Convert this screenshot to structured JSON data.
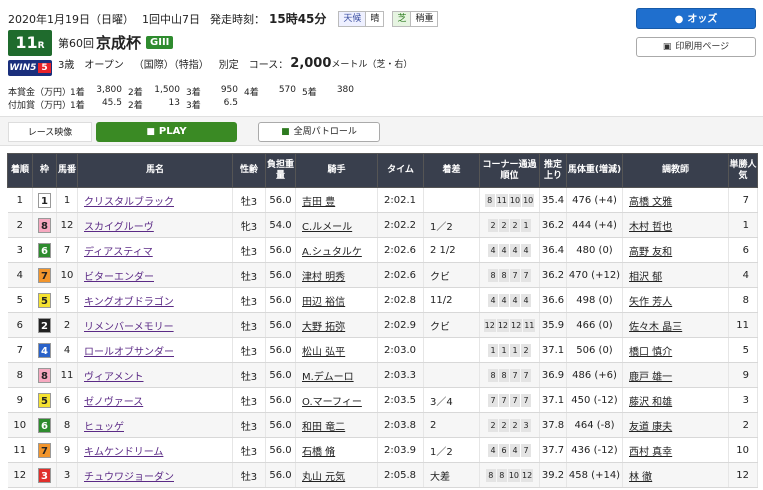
{
  "header": {
    "date": "2020年1月19日（日曜）",
    "meeting": "1回中山7日",
    "post_time_label": "発走時刻：",
    "post_time": "15時45分",
    "weather_label": "天候",
    "weather": "晴",
    "surface_label": "芝",
    "going": "稍重",
    "race_number": "11",
    "race_suffix": "R",
    "win5_label": "WIN5",
    "win5_number": "5",
    "edition": "第60回",
    "race_name": "京成杯",
    "grade": "GIII",
    "age": "3歳",
    "class": "オープン",
    "cond": "（国際）（特指）",
    "weight_rule": "別定",
    "course_label": "コース：",
    "distance": "2,000",
    "distance_unit": "メートル（芝・右）",
    "prize_label": "本賞金（万円）",
    "bonus_label": "付加賞（万円）",
    "prizes": [
      {
        "place": "1着",
        "value": "3,800"
      },
      {
        "place": "2着",
        "value": "1,500"
      },
      {
        "place": "3着",
        "value": "950"
      },
      {
        "place": "4着",
        "value": "570"
      },
      {
        "place": "5着",
        "value": "380"
      }
    ],
    "bonus": [
      {
        "place": "1着",
        "value": "45.5"
      },
      {
        "place": "2着",
        "value": "13"
      },
      {
        "place": "3着",
        "value": "6.5"
      }
    ]
  },
  "buttons": {
    "odds": "オッズ",
    "print": "印刷用ページ",
    "race_video": "レース映像",
    "play": "PLAY",
    "patrol": "全周パトロール"
  },
  "columns": [
    "着順",
    "枠",
    "馬番",
    "馬名",
    "性齢",
    "負担重量",
    "騎手",
    "タイム",
    "着差",
    "コーナー通過順位",
    "推定上り",
    "馬体重(増減)",
    "調教師",
    "単勝人気"
  ],
  "waku_colors": {
    "1": {
      "bg": "#ffffff",
      "fg": "#222222"
    },
    "2": {
      "bg": "#222222",
      "fg": "#ffffff"
    },
    "3": {
      "bg": "#e0302c",
      "fg": "#ffffff"
    },
    "4": {
      "bg": "#2a62c9",
      "fg": "#ffffff"
    },
    "5": {
      "bg": "#f5e231",
      "fg": "#222222"
    },
    "6": {
      "bg": "#2e8b2e",
      "fg": "#ffffff"
    },
    "7": {
      "bg": "#f2952c",
      "fg": "#222222"
    },
    "8": {
      "bg": "#f6a9c0",
      "fg": "#222222"
    }
  },
  "rows": [
    {
      "rank": "1",
      "waku": "1",
      "num": "1",
      "horse": "クリスタルブラック",
      "sex_age": "牡3",
      "weight": "56.0",
      "jockey": "吉田 豊",
      "time": "2:02.1",
      "margin": "",
      "corners": [
        "8",
        "11",
        "10",
        "10"
      ],
      "last3f": "35.4",
      "body": "476 (+4)",
      "trainer": "高橋 文雅",
      "pop": "7"
    },
    {
      "rank": "2",
      "waku": "8",
      "num": "12",
      "horse": "スカイグルーヴ",
      "sex_age": "牝3",
      "weight": "54.0",
      "jockey": "C.ルメール",
      "time": "2:02.2",
      "margin": "1／2",
      "corners": [
        "2",
        "2",
        "2",
        "1"
      ],
      "last3f": "36.2",
      "body": "444 (+4)",
      "trainer": "木村 哲也",
      "pop": "1"
    },
    {
      "rank": "3",
      "waku": "6",
      "num": "7",
      "horse": "ディアスティマ",
      "sex_age": "牡3",
      "weight": "56.0",
      "jockey": "A.シュタルケ",
      "time": "2:02.6",
      "margin": "2 1/2",
      "corners": [
        "4",
        "4",
        "4",
        "4"
      ],
      "last3f": "36.4",
      "body": "480 (0)",
      "trainer": "高野 友和",
      "pop": "6"
    },
    {
      "rank": "4",
      "waku": "7",
      "num": "10",
      "horse": "ビターエンダー",
      "sex_age": "牡3",
      "weight": "56.0",
      "jockey": "津村 明秀",
      "time": "2:02.6",
      "margin": "クビ",
      "corners": [
        "8",
        "8",
        "7",
        "7"
      ],
      "last3f": "36.2",
      "body": "470 (+12)",
      "trainer": "相沢 郁",
      "pop": "4"
    },
    {
      "rank": "5",
      "waku": "5",
      "num": "5",
      "horse": "キングオブドラゴン",
      "sex_age": "牡3",
      "weight": "56.0",
      "jockey": "田辺 裕信",
      "time": "2:02.8",
      "margin": "11/2",
      "corners": [
        "4",
        "4",
        "4",
        "4"
      ],
      "last3f": "36.6",
      "body": "498 (0)",
      "trainer": "矢作 芳人",
      "pop": "8"
    },
    {
      "rank": "6",
      "waku": "2",
      "num": "2",
      "horse": "リメンバーメモリー",
      "sex_age": "牡3",
      "weight": "56.0",
      "jockey": "大野 拓弥",
      "time": "2:02.9",
      "margin": "クビ",
      "corners": [
        "12",
        "12",
        "12",
        "11"
      ],
      "last3f": "35.9",
      "body": "466 (0)",
      "trainer": "佐々木 晶三",
      "pop": "11"
    },
    {
      "rank": "7",
      "waku": "4",
      "num": "4",
      "horse": "ロールオブサンダー",
      "sex_age": "牡3",
      "weight": "56.0",
      "jockey": "松山 弘平",
      "time": "2:03.0",
      "margin": "",
      "corners": [
        "1",
        "1",
        "1",
        "2"
      ],
      "last3f": "37.1",
      "body": "506 (0)",
      "trainer": "橋口 慎介",
      "pop": "5"
    },
    {
      "rank": "8",
      "waku": "8",
      "num": "11",
      "horse": "ヴィアメント",
      "sex_age": "牡3",
      "weight": "56.0",
      "jockey": "M.デムーロ",
      "time": "2:03.3",
      "margin": "",
      "corners": [
        "8",
        "8",
        "7",
        "7"
      ],
      "last3f": "36.9",
      "body": "486 (+6)",
      "trainer": "鹿戸 雄一",
      "pop": "9"
    },
    {
      "rank": "9",
      "waku": "5",
      "num": "6",
      "horse": "ゼノヴァース",
      "sex_age": "牡3",
      "weight": "56.0",
      "jockey": "O.マーフィー",
      "time": "2:03.5",
      "margin": "3／4",
      "corners": [
        "7",
        "7",
        "7",
        "7"
      ],
      "last3f": "37.1",
      "body": "450 (-12)",
      "trainer": "藤沢 和雄",
      "pop": "3"
    },
    {
      "rank": "10",
      "waku": "6",
      "num": "8",
      "horse": "ヒュッゲ",
      "sex_age": "牡3",
      "weight": "56.0",
      "jockey": "和田 竜二",
      "time": "2:03.8",
      "margin": "2",
      "corners": [
        "2",
        "2",
        "2",
        "3"
      ],
      "last3f": "37.8",
      "body": "464 (-8)",
      "trainer": "友道 康夫",
      "pop": "2"
    },
    {
      "rank": "11",
      "waku": "7",
      "num": "9",
      "horse": "キムケンドリーム",
      "sex_age": "牡3",
      "weight": "56.0",
      "jockey": "石橋 脩",
      "time": "2:03.9",
      "margin": "1／2",
      "corners": [
        "4",
        "6",
        "4",
        "7"
      ],
      "last3f": "37.7",
      "body": "436 (-12)",
      "trainer": "西村 真幸",
      "pop": "10"
    },
    {
      "rank": "12",
      "waku": "3",
      "num": "3",
      "horse": "チュウワジョーダン",
      "sex_age": "牡3",
      "weight": "56.0",
      "jockey": "丸山 元気",
      "time": "2:05.8",
      "margin": "大差",
      "corners": [
        "8",
        "8",
        "10",
        "12"
      ],
      "last3f": "39.2",
      "body": "458 (+14)",
      "trainer": "林 徹",
      "pop": "12"
    }
  ]
}
